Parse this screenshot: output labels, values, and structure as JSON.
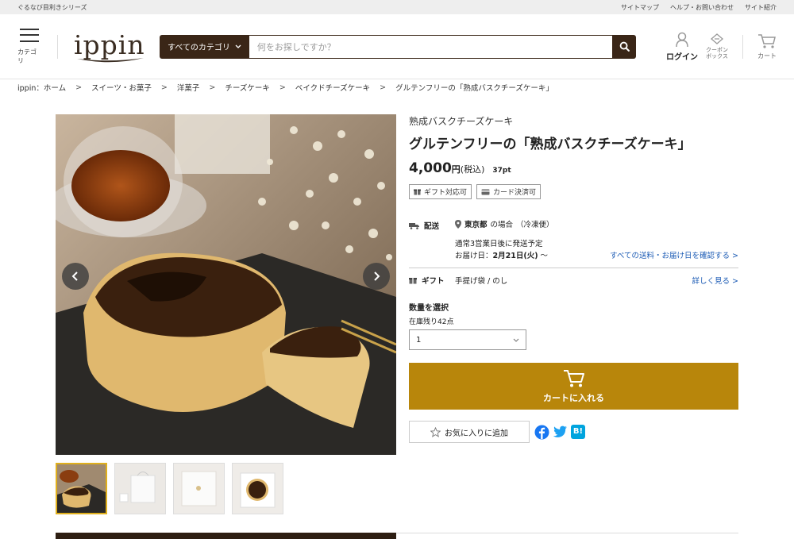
{
  "topbar": {
    "series": "ぐるなび目利きシリーズ",
    "links": [
      "サイトマップ",
      "ヘルプ・お問い合わせ",
      "サイト紹介"
    ]
  },
  "header": {
    "menu_label": "カテゴリ",
    "logo": "ippin",
    "search": {
      "category": "すべてのカテゴリ",
      "placeholder": "何をお探しですか？"
    },
    "login": "ログイン",
    "coupon_line1": "クーポン",
    "coupon_line2": "ボックス",
    "cart": "カート"
  },
  "breadcrumb": [
    "ippin：ホーム",
    "スイーツ・お菓子",
    "洋菓子",
    "チーズケーキ",
    "ベイクドチーズケーキ",
    "グルテンフリーの「熟成バスクチーズケーキ」"
  ],
  "breadcrumb_sep": ">",
  "product": {
    "subtitle": "熟成バスクチーズケーキ",
    "title": "グルテンフリーの「熟成バスクチーズケーキ」",
    "price": "4,000",
    "yen": "円",
    "tax": "(税込)",
    "points": "37pt",
    "badges": [
      "ギフト対応可",
      "カード決済可"
    ]
  },
  "shipping": {
    "label": "配送",
    "location": "東京都",
    "location_suffix": "の場合",
    "method": "（冷凍便）",
    "schedule": "通常3営業日後に発送予定",
    "delivery_prefix": "お届け日：",
    "delivery_date": "2月21日(火)",
    "delivery_suffix": " 〜",
    "link": "すべての送料・お届け日を確認する >"
  },
  "gift": {
    "label": "ギフト",
    "options": "手提げ袋 / のし",
    "link": "詳しく見る >"
  },
  "quantity": {
    "label": "数量を選択",
    "stock": "在庫残り42点",
    "selected": "1"
  },
  "cart_button": "カートに入れる",
  "favorite_button": "お気に入りに追加",
  "social_hatena": "B!",
  "colors": {
    "dark_brown": "#3a2617",
    "cart_gold": "#b8860b",
    "link_blue": "#1a5ab4",
    "thumb_selected": "#e0b01d",
    "facebook": "#1877f2",
    "twitter": "#1da1f2",
    "hatena": "#00a4de"
  }
}
